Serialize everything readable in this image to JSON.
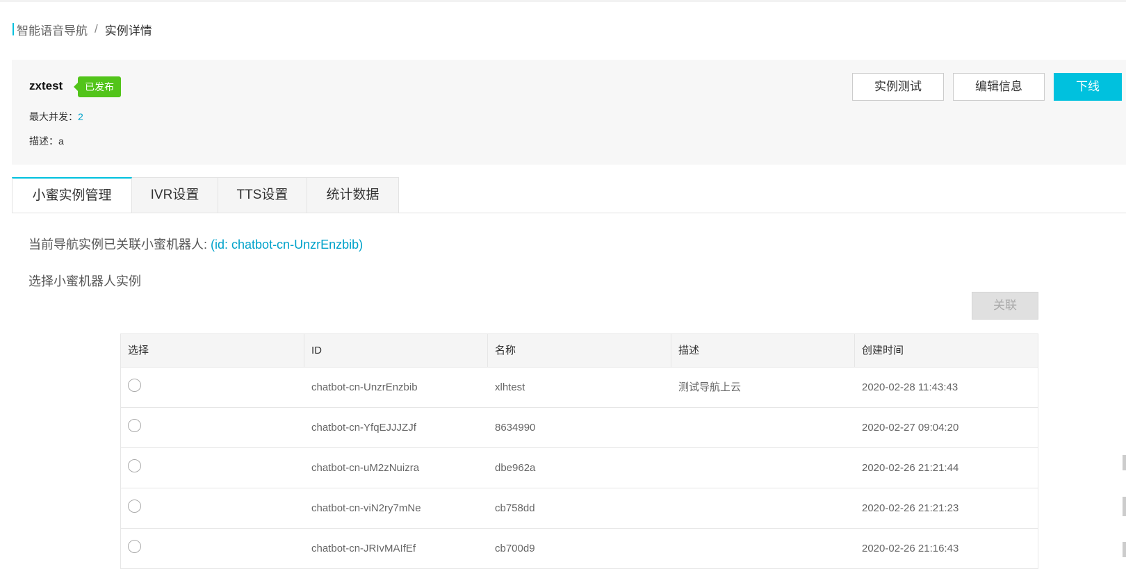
{
  "breadcrumb": {
    "parent": "智能语音导航",
    "separator": "/",
    "current": "实例详情"
  },
  "instance": {
    "name": "zxtest",
    "status": "已发布",
    "status_color": "#52c41a",
    "max_concurrency_label": "最大并发：",
    "max_concurrency_value": "2",
    "description_label": "描述：",
    "description_value": "a"
  },
  "actions": {
    "test_label": "实例测试",
    "edit_label": "编辑信息",
    "offline_label": "下线"
  },
  "tabs": [
    {
      "label": "小蜜实例管理",
      "active": true
    },
    {
      "label": "IVR设置",
      "active": false
    },
    {
      "label": "TTS设置",
      "active": false
    },
    {
      "label": "统计数据",
      "active": false
    }
  ],
  "bot": {
    "linked_text": "当前导航实例已关联小蜜机器人: ",
    "linked_id": "(id: chatbot-cn-UnzrEnzbib)",
    "select_title": "选择小蜜机器人实例",
    "link_button_label": "关联"
  },
  "table": {
    "columns": [
      "选择",
      "ID",
      "名称",
      "描述",
      "创建时间"
    ],
    "rows": [
      {
        "id": "chatbot-cn-UnzrEnzbib",
        "name": "xlhtest",
        "description": "测试导航上云",
        "created": "2020-02-28 11:43:43"
      },
      {
        "id": "chatbot-cn-YfqEJJJZJf",
        "name": "8634990",
        "description": "",
        "created": "2020-02-27 09:04:20"
      },
      {
        "id": "chatbot-cn-uM2zNuizra",
        "name": "dbe962a",
        "description": "",
        "created": "2020-02-26 21:21:44"
      },
      {
        "id": "chatbot-cn-viN2ry7mNe",
        "name": "cb758dd",
        "description": "",
        "created": "2020-02-26 21:21:23"
      },
      {
        "id": "chatbot-cn-JRIvMAIfEf",
        "name": "cb700d9",
        "description": "",
        "created": "2020-02-26 21:16:43"
      }
    ]
  },
  "colors": {
    "accent": "#00c1de",
    "link": "#00a2ca",
    "published": "#52c41a"
  }
}
